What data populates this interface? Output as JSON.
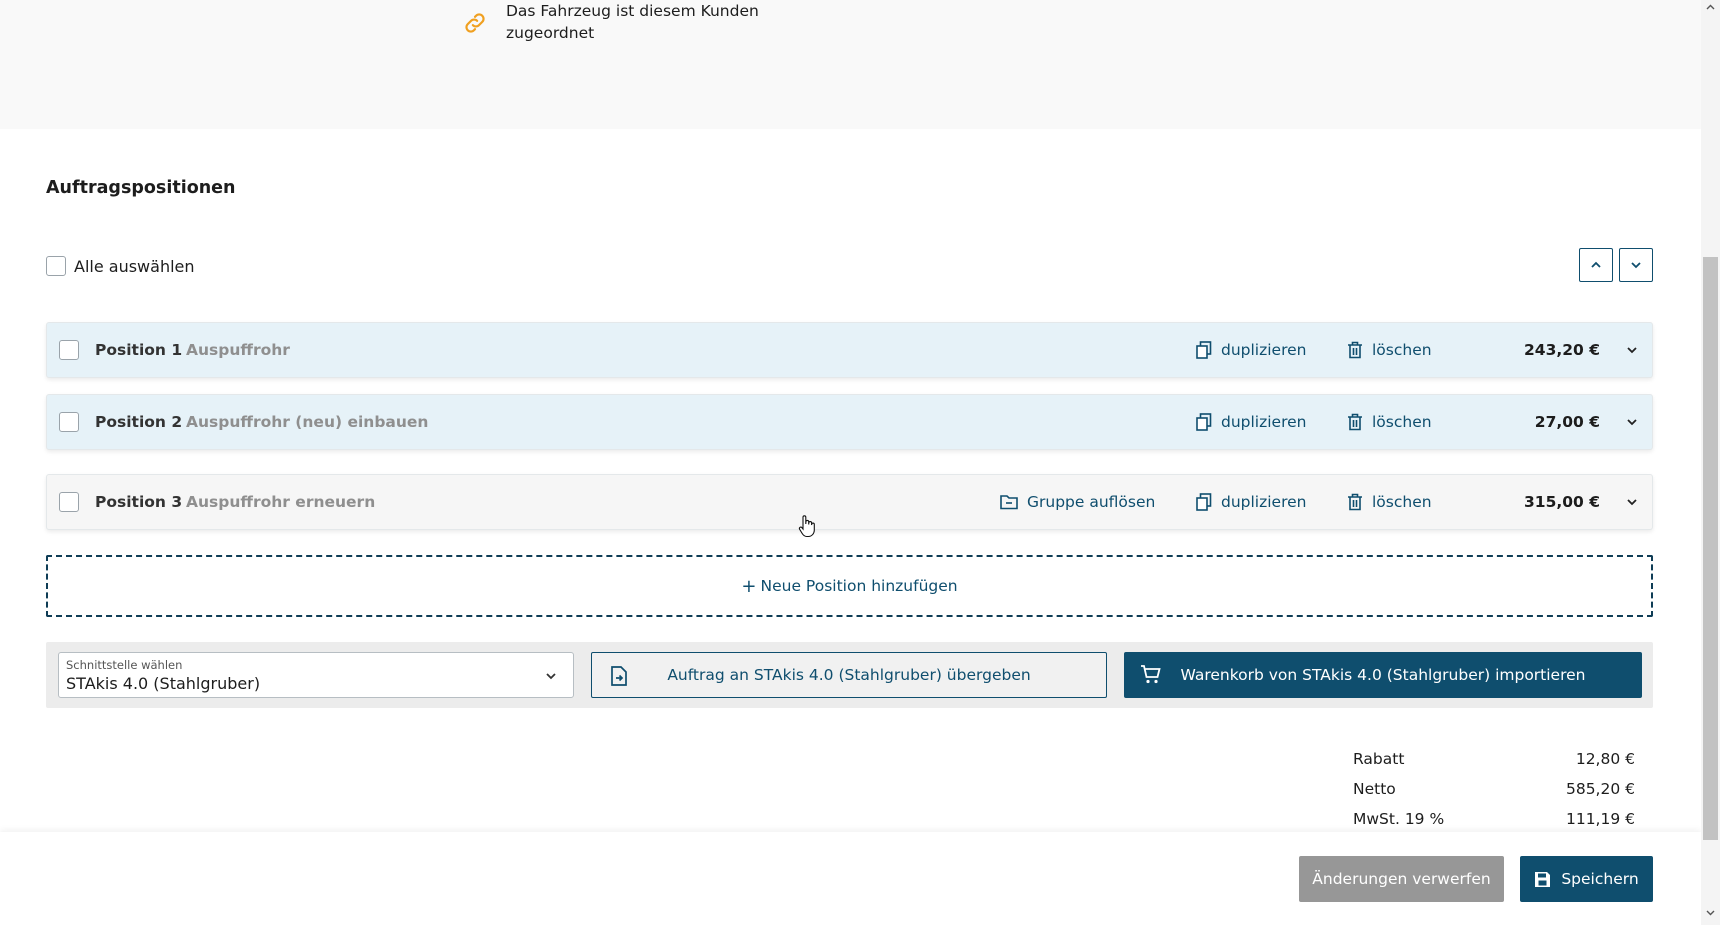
{
  "vehicle": {
    "link_note": "Das Fahrzeug ist diesem Kunden zugeordnet"
  },
  "positions_section": {
    "title": "Auftragspositionen",
    "select_all_label": "Alle auswählen",
    "positions": [
      {
        "label": "Position 1",
        "description": "Auspuffrohr",
        "amount": "243,20 €",
        "duplicate": "duplizieren",
        "delete": "löschen"
      },
      {
        "label": "Position 2",
        "description": "Auspuffrohr (neu) einbauen",
        "amount": "27,00 €",
        "duplicate": "duplizieren",
        "delete": "löschen"
      },
      {
        "label": "Position 3",
        "description": "Auspuffrohr erneuern",
        "amount": "315,00 €",
        "duplicate": "duplizieren",
        "delete": "löschen",
        "ungroup": "Gruppe auflösen"
      }
    ],
    "add_position": "Neue Position hinzufügen",
    "add_position_plus": "+"
  },
  "interface": {
    "select_label": "Schnittstelle wählen",
    "select_value": "STAkis 4.0 (Stahlgruber)",
    "transfer_button": "Auftrag an STAkis 4.0 (Stahlgruber) übergeben",
    "import_button": "Warenkorb von STAkis 4.0 (Stahlgruber) importieren"
  },
  "totals": [
    {
      "label": "Rabatt",
      "value": "12,80 €"
    },
    {
      "label": "Netto",
      "value": "585,20 €"
    },
    {
      "label": "MwSt. 19 %",
      "value": "111,19 €"
    }
  ],
  "footer": {
    "discard_button": "Änderungen verwerfen",
    "save_button": "Speichern"
  },
  "colors": {
    "primary": "#0f4e6e",
    "link_icon": "#f0a020",
    "row_highlight": "#e6f2f8",
    "discard": "#979797"
  },
  "icons": [
    "link-icon",
    "chevron-up-icon",
    "chevron-down-icon",
    "duplicate-icon",
    "trash-icon",
    "folder-icon",
    "document-transfer-icon",
    "cart-icon",
    "save-icon"
  ]
}
